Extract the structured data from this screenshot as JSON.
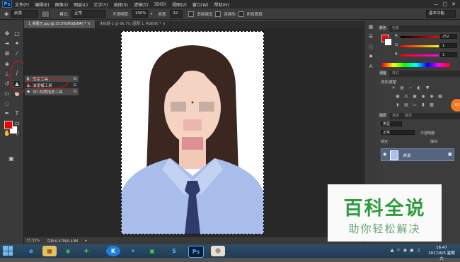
{
  "app": {
    "logo": "Ps"
  },
  "menu": [
    "文件(F)",
    "编辑(E)",
    "图像(I)",
    "图层(L)",
    "文字(Y)",
    "选择(S)",
    "滤镜(T)",
    "3D(D)",
    "视图(V)",
    "窗口(W)",
    "帮助(H)"
  ],
  "window_controls": {
    "minimize": "—",
    "maximize": "□",
    "close": "✕"
  },
  "options_bar": {
    "preset": "前景",
    "mode_label": "模式:",
    "mode_value": "正常",
    "opacity_label": "不透明度:",
    "opacity_value": "100%",
    "tolerance_label": "容差:",
    "tolerance_value": "32",
    "antialias_label": "消除锯齿",
    "contiguous_label": "连续的",
    "all_layers_label": "所有图层",
    "workspace": "基本功能"
  },
  "tabs": [
    {
      "label": "1_看图王.jpg @ 33.3%(RGB/8#) *",
      "close": "×"
    },
    {
      "label": "未标题-1 @ 66.7% (图层 1, RGB/8) *",
      "close": "×"
    }
  ],
  "flyout": {
    "items": [
      {
        "label": "渐变工具",
        "shortcut": "G"
      },
      {
        "label": "油漆桶工具",
        "shortcut": "G"
      },
      {
        "label": "3D 材质拖放工具",
        "shortcut": "G"
      }
    ]
  },
  "status": {
    "zoom": "33.33%",
    "doc": "文档:6.67M/6.49M"
  },
  "color_panel": {
    "tabs": [
      "颜色",
      "色板"
    ],
    "channels": [
      {
        "label": "R",
        "value": "252"
      },
      {
        "label": "G",
        "value": "1"
      },
      {
        "label": "B",
        "value": "1"
      }
    ],
    "fg_color": "#fc0101",
    "bg_color": "#ffffff"
  },
  "adjustments_panel": {
    "tabs": [
      "调整",
      "样式"
    ],
    "title": "添加调整"
  },
  "layers_panel": {
    "tabs": [
      "图层",
      "通道",
      "路径"
    ],
    "filter": "类型",
    "blend_mode": "正常",
    "opacity_label": "不透明度:",
    "lock_label": "锁定:",
    "fill_label": "填充:",
    "layer_name": "背景"
  },
  "watermark": {
    "top": "百科全说",
    "bottom": "助你轻松解决"
  },
  "taskbar": {
    "time": "16:47",
    "date": "2017/6/5 星期六"
  },
  "side_button": "63"
}
